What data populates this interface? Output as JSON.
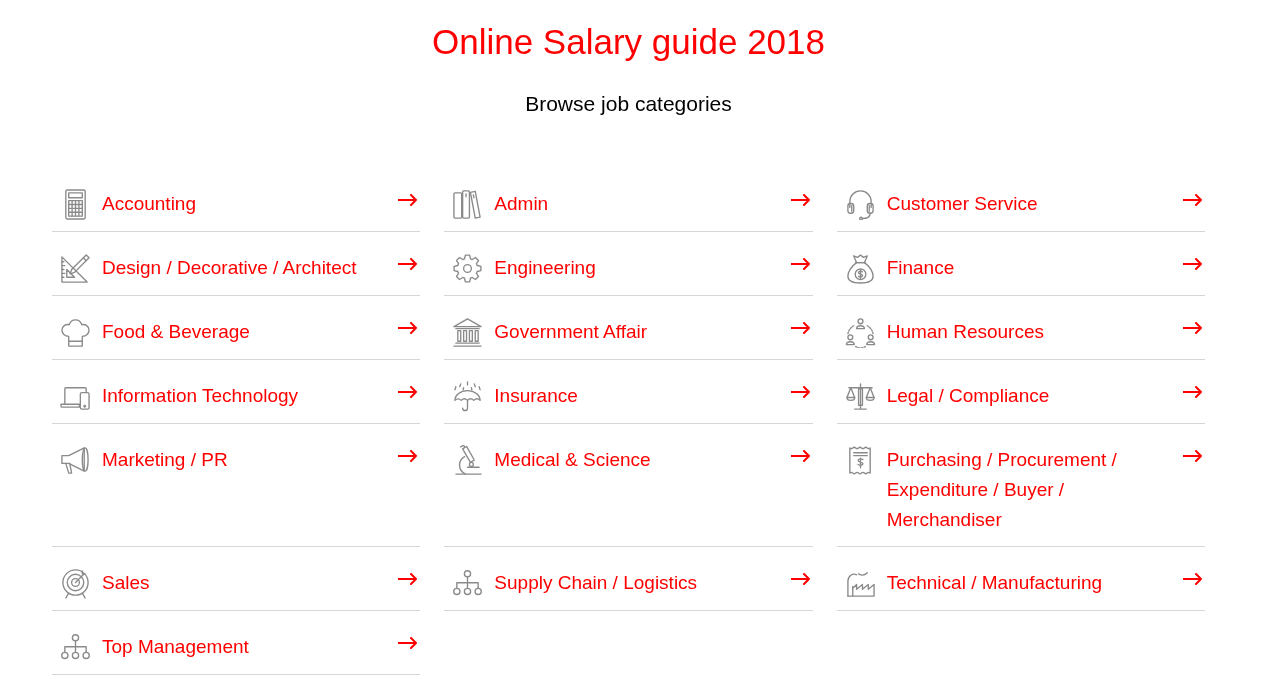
{
  "title": "Online Salary guide 2018",
  "subtitle": "Browse job categories",
  "categories": [
    {
      "label": "Accounting",
      "kind": "accounting"
    },
    {
      "label": "Admin",
      "kind": "admin"
    },
    {
      "label": "Customer Service",
      "kind": "service"
    },
    {
      "label": "Design / Decorative / Architect",
      "kind": "design"
    },
    {
      "label": "Engineering",
      "kind": "engineering"
    },
    {
      "label": "Finance",
      "kind": "finance"
    },
    {
      "label": "Food & Beverage",
      "kind": "food"
    },
    {
      "label": "Government Affair",
      "kind": "government"
    },
    {
      "label": "Human Resources",
      "kind": "hr"
    },
    {
      "label": "Information Technology",
      "kind": "it"
    },
    {
      "label": "Insurance",
      "kind": "insurance"
    },
    {
      "label": "Legal / Compliance",
      "kind": "legal"
    },
    {
      "label": "Marketing / PR",
      "kind": "marketing"
    },
    {
      "label": "Medical & Science",
      "kind": "medical"
    },
    {
      "label": "Purchasing / Procurement / Expenditure / Buyer / Merchandiser",
      "kind": "purchasing"
    },
    {
      "label": "Sales",
      "kind": "sales"
    },
    {
      "label": "Supply Chain / Logistics",
      "kind": "supply"
    },
    {
      "label": "Technical / Manufacturing",
      "kind": "technical"
    },
    {
      "label": "Top Management",
      "kind": "management"
    }
  ]
}
